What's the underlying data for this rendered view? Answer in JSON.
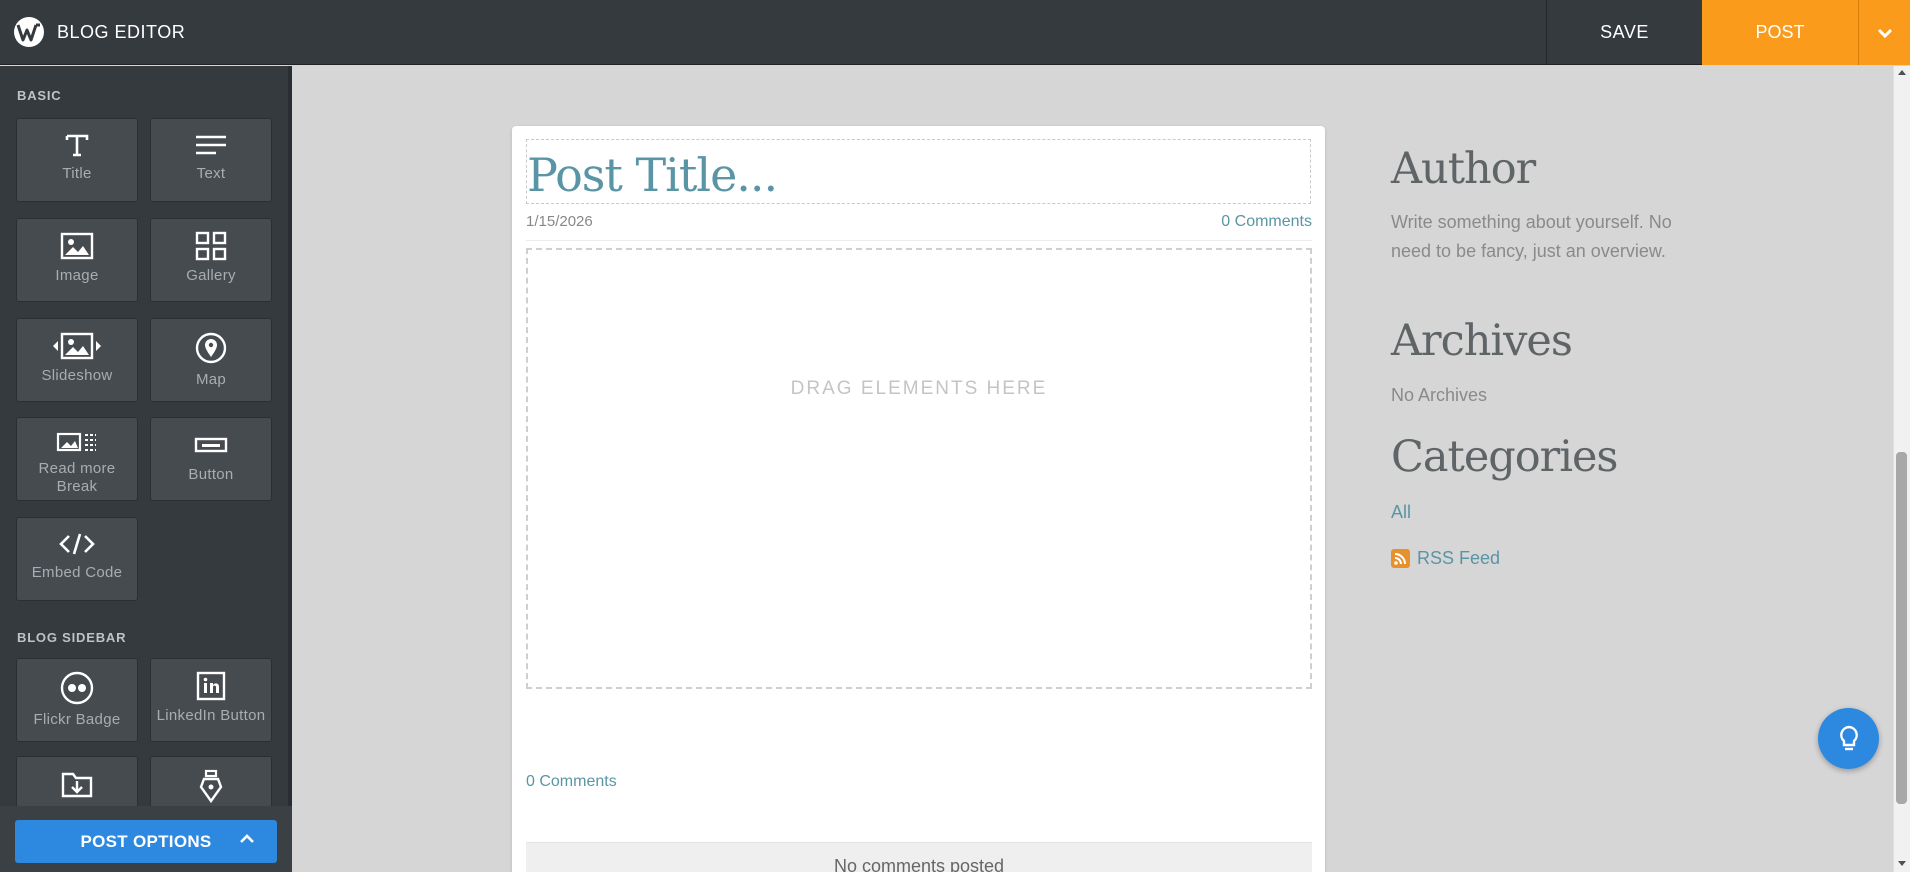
{
  "app": {
    "title": "BLOG EDITOR"
  },
  "toolbar": {
    "save_label": "SAVE",
    "post_label": "POST"
  },
  "sidebar": {
    "basic_title": "BASIC",
    "basic_items": [
      {
        "label": "Title",
        "icon": "title-icon"
      },
      {
        "label": "Text",
        "icon": "text-icon"
      },
      {
        "label": "Image",
        "icon": "image-icon"
      },
      {
        "label": "Gallery",
        "icon": "gallery-icon"
      },
      {
        "label": "Slideshow",
        "icon": "slideshow-icon"
      },
      {
        "label": "Map",
        "icon": "map-pin-icon"
      },
      {
        "label": "Read more Break",
        "icon": "read-more-icon"
      },
      {
        "label": "Button",
        "icon": "button-icon"
      },
      {
        "label": "Embed Code",
        "icon": "code-icon"
      }
    ],
    "blog_sidebar_title": "BLOG SIDEBAR",
    "blog_sidebar_items": [
      {
        "label": "Flickr Badge",
        "icon": "flickr-icon"
      },
      {
        "label": "LinkedIn Button",
        "icon": "linkedin-icon"
      },
      {
        "label": "",
        "icon": "folder-download-icon"
      },
      {
        "label": "",
        "icon": "pen-nib-icon"
      }
    ],
    "post_options_label": "POST OPTIONS"
  },
  "post": {
    "title_placeholder": "Post Title...",
    "date": "1/15/2026",
    "comments_count_label": "0 Comments",
    "drop_zone_text": "DRAG ELEMENTS HERE",
    "comments_bottom_label": "0 Comments",
    "no_comments_text": "No comments posted"
  },
  "blog_sidebar": {
    "author_heading": "Author",
    "author_text": "Write something about yourself. No need to be fancy, just an overview.",
    "archives_heading": "Archives",
    "archives_text": "No Archives",
    "categories_heading": "Categories",
    "categories_all": "All",
    "rss_label": "RSS Feed"
  },
  "colors": {
    "topbar": "#353a3f",
    "post_button": "#fa9b1b",
    "accent_blue": "#2d88e0",
    "link_teal": "#5a95a5"
  }
}
